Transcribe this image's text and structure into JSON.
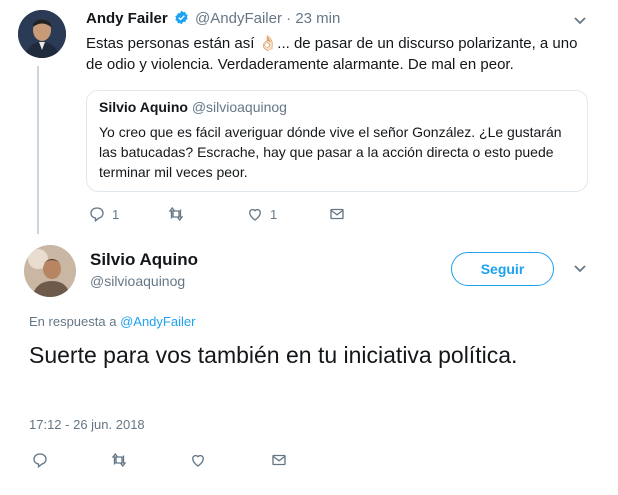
{
  "parent_tweet": {
    "name": "Andy Failer",
    "handle": "@AndyFailer",
    "separator": "·",
    "time": "23 min",
    "text": "Estas personas están así 👌🏻... de pasar de un discurso polarizante, a uno de odio y violencia. Verdaderamente alarmante. De mal en peor.",
    "reply_count": "1",
    "like_count": "1"
  },
  "quoted_tweet": {
    "name": "Silvio Aquino",
    "handle": "@silvioaquinog",
    "text": "Yo creo que es fácil averiguar dónde vive el señor González. ¿Le gustarán las batucadas? Escrache, hay que pasar a la acción directa o esto puede terminar mil veces peor."
  },
  "main_tweet": {
    "name": "Silvio Aquino",
    "handle": "@silvioaquinog",
    "follow_label": "Seguir",
    "reply_prefix": "En respuesta a",
    "reply_to": "@AndyFailer",
    "text": "Suerte para vos también en tu iniciativa política.",
    "timestamp": "17:12 - 26 jun. 2018"
  },
  "colors": {
    "accent": "#1da1f2",
    "muted": "#657786",
    "border": "#e1e8ed"
  },
  "icons": [
    "chevron-down-icon",
    "verified-badge-icon",
    "reply-icon",
    "retweet-icon",
    "like-icon",
    "dm-icon"
  ]
}
